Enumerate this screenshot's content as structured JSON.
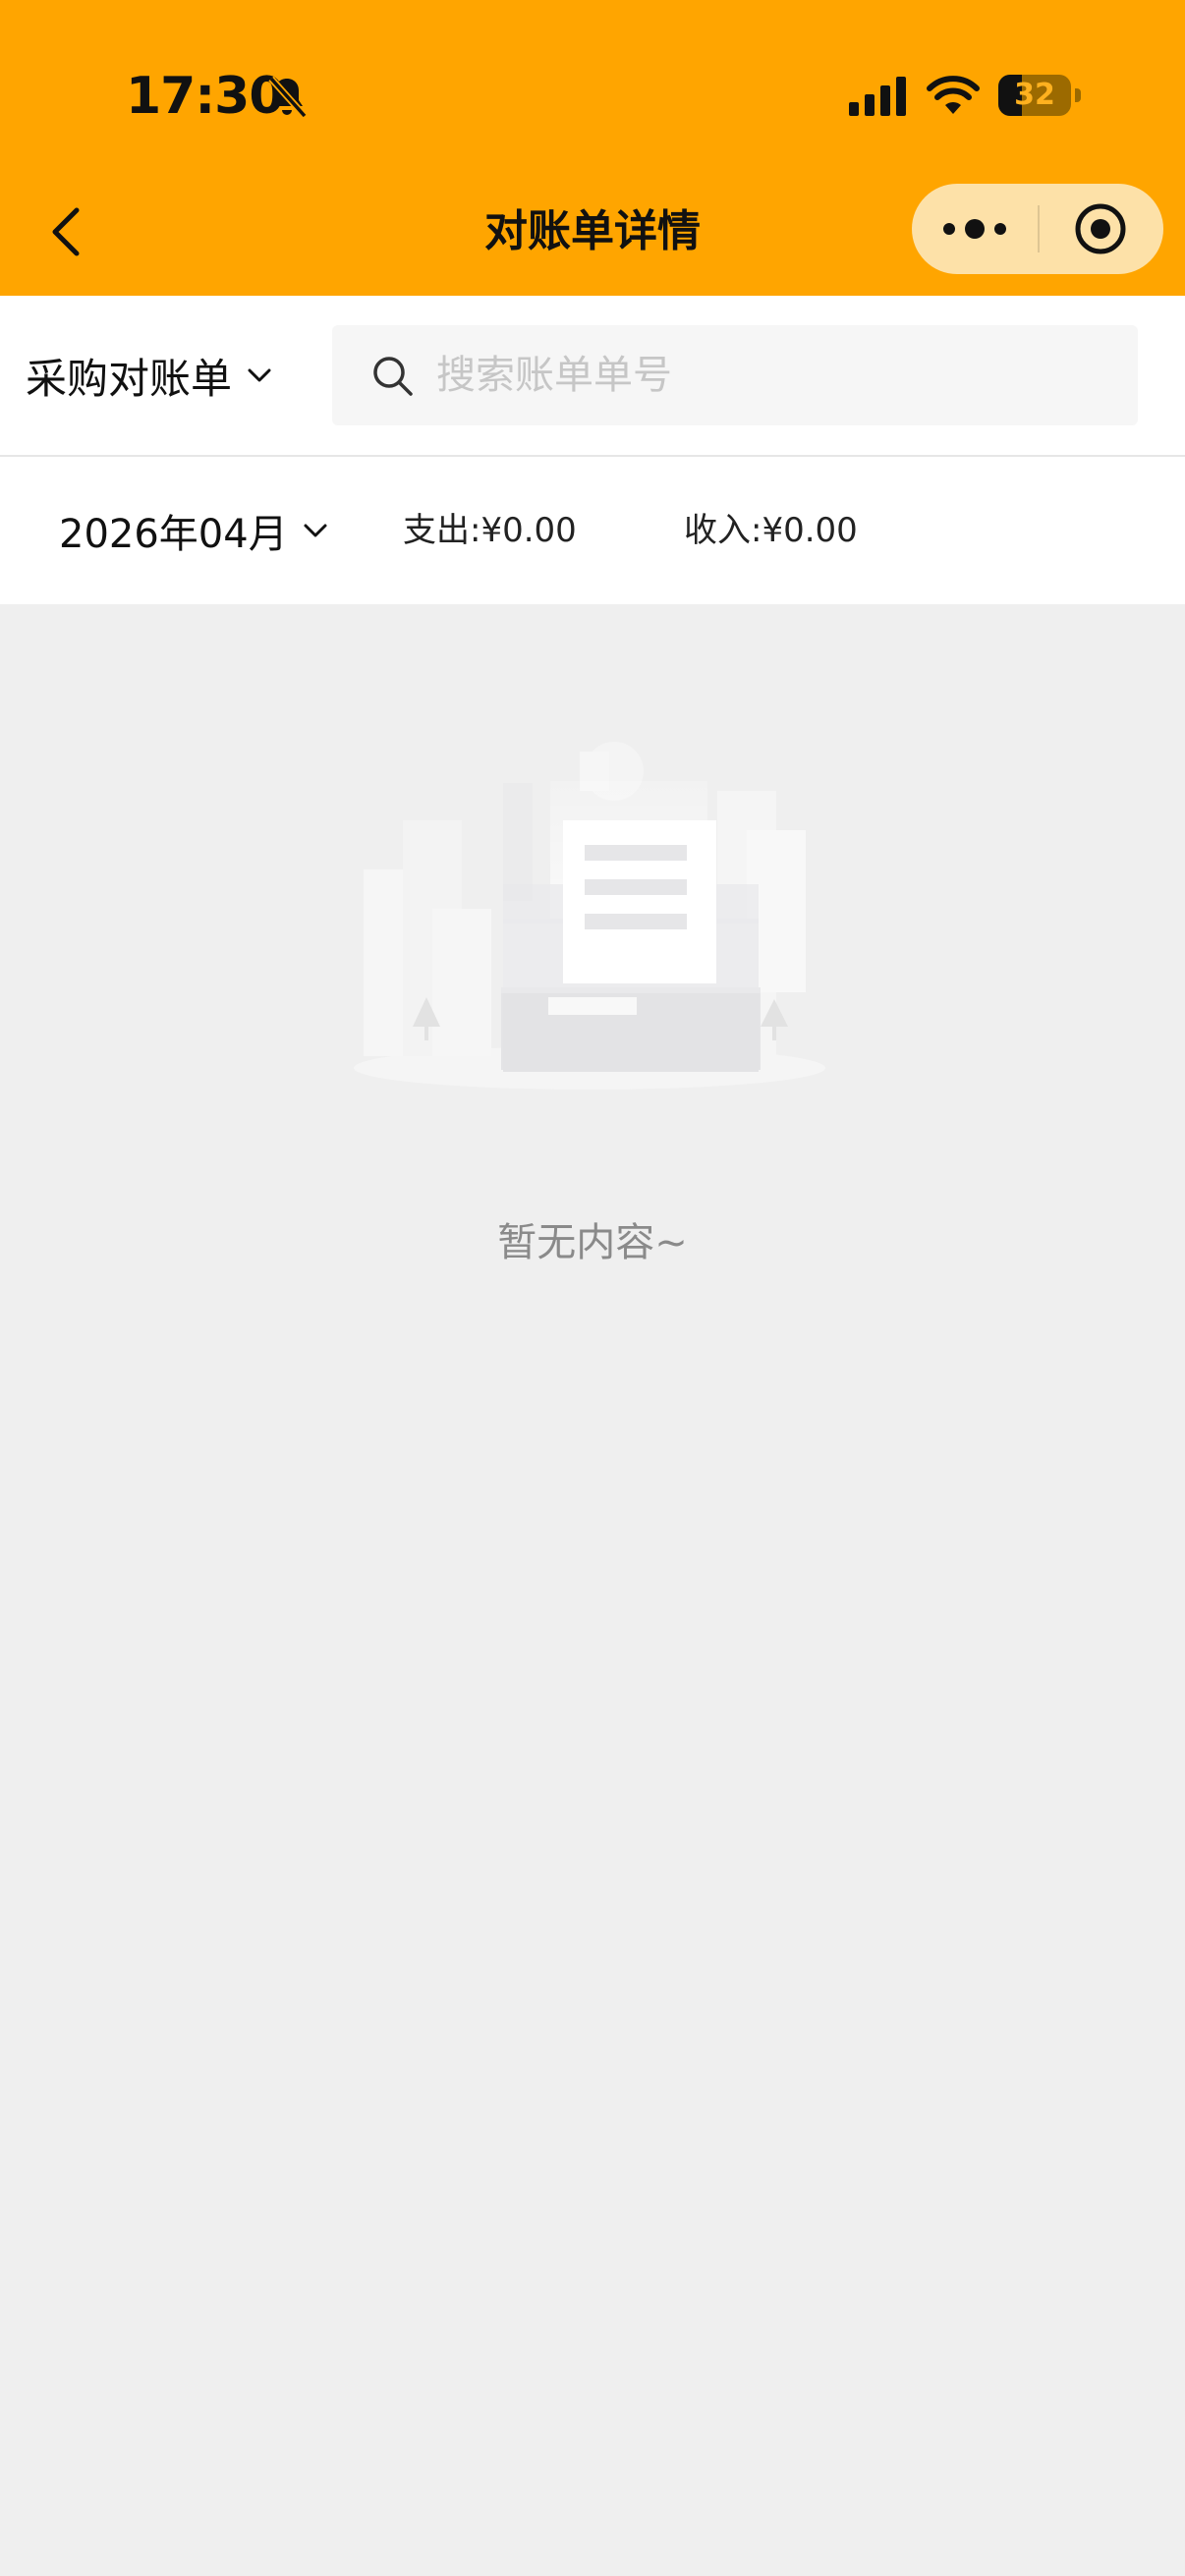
{
  "status_bar": {
    "time": "17:30",
    "battery_level": "32",
    "battery_fraction": 0.32,
    "icons": [
      "bell-off-icon",
      "signal-icon",
      "wifi-icon",
      "battery-icon"
    ]
  },
  "nav": {
    "title": "对账单详情",
    "back_icon": "chevron-left-icon",
    "more_icon": "more-dots-icon",
    "close_icon": "target-circle-icon"
  },
  "filter": {
    "type_label": "采购对账单",
    "search_placeholder": "搜索账单单号",
    "search_value": ""
  },
  "summary": {
    "month_label": "2026年04月",
    "expense_label": "支出:",
    "expense_value": "¥0.00",
    "income_label": "收入:",
    "income_value": "¥0.00"
  },
  "empty": {
    "message": "暂无内容~"
  },
  "colors": {
    "header_bg": "#ffa500",
    "capsule_bg": "#fde1a8",
    "page_bg": "#efefef",
    "muted_text": "#8a8a8a",
    "placeholder": "#c6c6c6"
  }
}
